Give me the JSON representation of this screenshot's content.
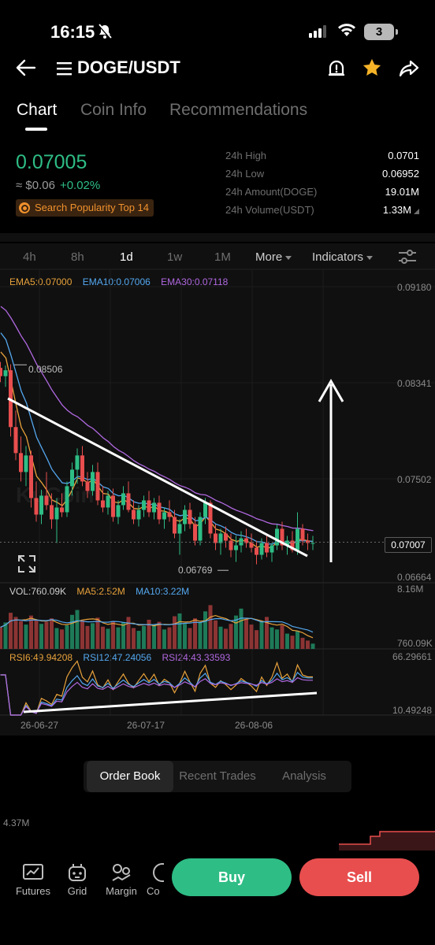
{
  "status_bar": {
    "time": "16:15",
    "battery": "3"
  },
  "nav": {
    "pair": "DOGE/USDT"
  },
  "tabs": [
    {
      "label": "Chart",
      "active": true
    },
    {
      "label": "Coin Info",
      "active": false
    },
    {
      "label": "Recommendations",
      "active": false
    }
  ],
  "price": {
    "last": "0.07005",
    "fiat": "≈ $0.06",
    "change": "+0.02%",
    "popularity": "Search Popularity Top 14"
  },
  "stats": [
    {
      "label": "24h High",
      "value": "0.0701"
    },
    {
      "label": "24h Low",
      "value": "0.06952"
    },
    {
      "label": "24h Amount(DOGE)",
      "value": "19.01M"
    },
    {
      "label": "24h Volume(USDT)",
      "value": "1.33M"
    }
  ],
  "intervals": {
    "i4h": "4h",
    "i8h": "8h",
    "i1d": "1d",
    "i1w": "1w",
    "i1M": "1M",
    "more": "More",
    "indicators": "Indicators"
  },
  "legends": {
    "ema5": "EMA5:0.07000",
    "ema10": "EMA10:0.07006",
    "ema30": "EMA30:0.07118",
    "vol": "VOL:760.09K",
    "ma5": "MA5:2.52M",
    "ma10": "MA10:3.22M",
    "rsi6": "RSI6:49.94208",
    "rsi12": "RSI12:47.24056",
    "rsi24": "RSI24:43.33593"
  },
  "axis": {
    "y1": "0.09180",
    "y2": "0.08341",
    "y3": "0.07502",
    "y4": "0.06664",
    "current": "0.07007",
    "high_mark": "0.08506",
    "low_mark": "0.06769",
    "vol_top": "8.16M",
    "vol_bottom": "760.09K",
    "rsi_top": "66.29661",
    "rsi_bottom": "10.49248",
    "dates": [
      "26-06-27",
      "26-07-17",
      "26-08-06"
    ]
  },
  "colors": {
    "up": "#2ebd85",
    "down": "#e84e4e",
    "ema5": "#e8a23b",
    "ema10": "#54a8f0",
    "ema30": "#b068e0"
  },
  "candles": [
    [
      0.0848,
      0.0853,
      0.0836,
      0.0841
    ],
    [
      0.0841,
      0.085,
      0.0832,
      0.0846
    ],
    [
      0.0846,
      0.0851,
      0.079,
      0.0798
    ],
    [
      0.0798,
      0.0812,
      0.077,
      0.0776
    ],
    [
      0.0776,
      0.079,
      0.0752,
      0.076
    ],
    [
      0.076,
      0.0782,
      0.0748,
      0.0774
    ],
    [
      0.0774,
      0.0778,
      0.073,
      0.0738
    ],
    [
      0.0738,
      0.0752,
      0.0718,
      0.0724
    ],
    [
      0.0724,
      0.0745,
      0.0716,
      0.074
    ],
    [
      0.074,
      0.076,
      0.0728,
      0.0732
    ],
    [
      0.0732,
      0.0742,
      0.0712,
      0.072
    ],
    [
      0.072,
      0.0738,
      0.07,
      0.073
    ],
    [
      0.073,
      0.0742,
      0.0722,
      0.0726
    ],
    [
      0.0726,
      0.0752,
      0.0722,
      0.0748
    ],
    [
      0.0748,
      0.0768,
      0.074,
      0.0762
    ],
    [
      0.0762,
      0.078,
      0.075,
      0.0774
    ],
    [
      0.0774,
      0.0782,
      0.0748,
      0.0752
    ],
    [
      0.0752,
      0.076,
      0.0738,
      0.0744
    ],
    [
      0.0744,
      0.0766,
      0.074,
      0.076
    ],
    [
      0.076,
      0.0768,
      0.0732,
      0.0736
    ],
    [
      0.0736,
      0.0748,
      0.0726,
      0.073
    ],
    [
      0.073,
      0.0744,
      0.0724,
      0.074
    ],
    [
      0.074,
      0.0746,
      0.0718,
      0.0722
    ],
    [
      0.0722,
      0.0736,
      0.0716,
      0.0732
    ],
    [
      0.0732,
      0.0748,
      0.0728,
      0.0742
    ],
    [
      0.0742,
      0.0752,
      0.0726,
      0.0728
    ],
    [
      0.0728,
      0.0736,
      0.0716,
      0.072
    ],
    [
      0.072,
      0.0732,
      0.0714,
      0.0728
    ],
    [
      0.0728,
      0.074,
      0.0722,
      0.0736
    ],
    [
      0.0736,
      0.0744,
      0.0722,
      0.0726
    ],
    [
      0.0726,
      0.0738,
      0.072,
      0.0734
    ],
    [
      0.0734,
      0.074,
      0.0716,
      0.072
    ],
    [
      0.072,
      0.073,
      0.0712,
      0.0726
    ],
    [
      0.0726,
      0.0736,
      0.0718,
      0.0722
    ],
    [
      0.0722,
      0.0728,
      0.0704,
      0.0708
    ],
    [
      0.0708,
      0.072,
      0.069,
      0.0716
    ],
    [
      0.0716,
      0.0732,
      0.071,
      0.0728
    ],
    [
      0.0728,
      0.0734,
      0.0712,
      0.0716
    ],
    [
      0.0716,
      0.0722,
      0.0698,
      0.0702
    ],
    [
      0.0702,
      0.0726,
      0.0698,
      0.0722
    ],
    [
      0.0722,
      0.0738,
      0.0716,
      0.0734
    ],
    [
      0.0734,
      0.0736,
      0.0704,
      0.0708
    ],
    [
      0.0708,
      0.0716,
      0.0694,
      0.07
    ],
    [
      0.07,
      0.0712,
      0.069,
      0.0708
    ],
    [
      0.0708,
      0.0714,
      0.0696,
      0.0702
    ],
    [
      0.0702,
      0.0708,
      0.0688,
      0.0694
    ],
    [
      0.0694,
      0.0706,
      0.0684,
      0.0698
    ],
    [
      0.0698,
      0.071,
      0.0692,
      0.0704
    ],
    [
      0.0704,
      0.0712,
      0.0696,
      0.07
    ],
    [
      0.07,
      0.0708,
      0.0692,
      0.0696
    ],
    [
      0.0696,
      0.0702,
      0.0682,
      0.069
    ],
    [
      0.069,
      0.0704,
      0.0686,
      0.07
    ],
    [
      0.07,
      0.0708,
      0.0688,
      0.0692
    ],
    [
      0.0692,
      0.07,
      0.0684,
      0.0698
    ],
    [
      0.0698,
      0.0716,
      0.0694,
      0.0712
    ],
    [
      0.0712,
      0.0718,
      0.0694,
      0.0698
    ],
    [
      0.0698,
      0.0706,
      0.069,
      0.0702
    ],
    [
      0.0702,
      0.071,
      0.0692,
      0.0694
    ],
    [
      0.0694,
      0.0726,
      0.069,
      0.0712
    ],
    [
      0.0712,
      0.0716,
      0.0698,
      0.0702
    ],
    [
      0.0702,
      0.0708,
      0.0694,
      0.07
    ],
    [
      0.07,
      0.0706,
      0.0694,
      0.07
    ]
  ],
  "volumes": [
    3.1,
    3.8,
    5.2,
    4.6,
    4.0,
    3.5,
    4.8,
    4.2,
    3.6,
    3.9,
    4.4,
    3.0,
    2.8,
    3.4,
    4.9,
    5.6,
    4.1,
    3.3,
    3.7,
    4.5,
    3.2,
    2.9,
    4.0,
    3.1,
    3.8,
    4.6,
    3.0,
    2.6,
    3.3,
    4.2,
    3.5,
    3.9,
    2.8,
    3.1,
    4.7,
    5.1,
    3.6,
    3.0,
    4.4,
    3.8,
    5.4,
    6.3,
    4.1,
    3.2,
    2.9,
    3.6,
    4.8,
    5.8,
    4.3,
    3.5,
    2.7,
    3.9,
    4.6,
    3.1,
    2.8,
    3.4,
    2.2,
    1.9,
    2.6,
    1.6,
    1.2,
    0.76
  ],
  "order_tabs": {
    "book": "Order Book",
    "trades": "Recent Trades",
    "analysis": "Analysis"
  },
  "depth_label": "4.37M",
  "bottom_nav": [
    "Futures",
    "Grid",
    "Margin",
    "Co"
  ],
  "actions": {
    "buy": "Buy",
    "sell": "Sell"
  }
}
